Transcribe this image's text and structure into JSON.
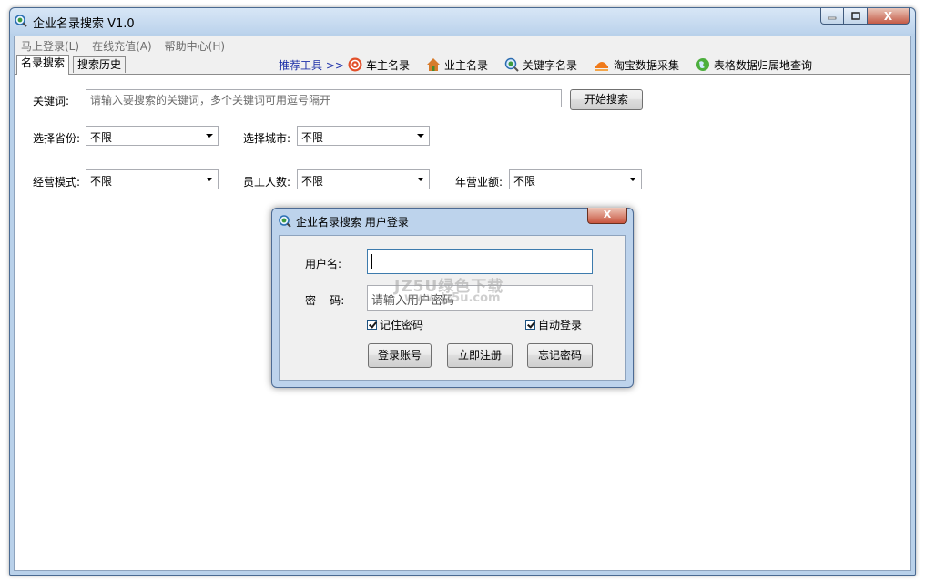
{
  "window": {
    "title": "企业名录搜索 V1.0"
  },
  "window_controls": {
    "close_label": "X"
  },
  "menubar": {
    "items": [
      "马上登录(L)",
      "在线充值(A)",
      "帮助中心(H)"
    ]
  },
  "tabs": [
    {
      "label": "名录搜索",
      "active": true
    },
    {
      "label": "搜索历史",
      "active": false
    }
  ],
  "tools": {
    "label": "推荐工具 >>",
    "items": [
      {
        "label": "车主名录",
        "icon": "car-owner-icon"
      },
      {
        "label": "业主名录",
        "icon": "house-icon"
      },
      {
        "label": "关键字名录",
        "icon": "search-globe-icon"
      },
      {
        "label": "淘宝数据采集",
        "icon": "taobao-icon"
      },
      {
        "label": "表格数据归属地查询",
        "icon": "globe-icon"
      }
    ]
  },
  "search": {
    "keyword_label": "关键词:",
    "keyword_placeholder": "请输入要搜索的关键词，多个关键词可用逗号隔开",
    "search_button": "开始搜索"
  },
  "filters": {
    "province": {
      "label": "选择省份:",
      "value": "不限"
    },
    "city": {
      "label": "选择城市:",
      "value": "不限"
    },
    "business_mode": {
      "label": "经营模式:",
      "value": "不限"
    },
    "employees": {
      "label": "员工人数:",
      "value": "不限"
    },
    "revenue": {
      "label": "年营业额:",
      "value": "不限"
    }
  },
  "login_dialog": {
    "title": "企业名录搜索 用户登录",
    "close_label": "X",
    "username_label": "用户名:",
    "username_value": "",
    "password_label": "密    码:",
    "password_placeholder": "请输入用户密码",
    "remember_label": "记住密码",
    "remember_checked": true,
    "auto_login_label": "自动登录",
    "auto_login_checked": true,
    "login_button": "登录账号",
    "register_button": "立即注册",
    "forgot_button": "忘记密码"
  },
  "watermark": {
    "line1": "JZ5U绿色下载",
    "line2": "www.jz5u.com"
  },
  "colors": {
    "tools_label": "#1c2fa8",
    "window_frame": "#b9d1ea",
    "close_button": "#c45a46"
  }
}
